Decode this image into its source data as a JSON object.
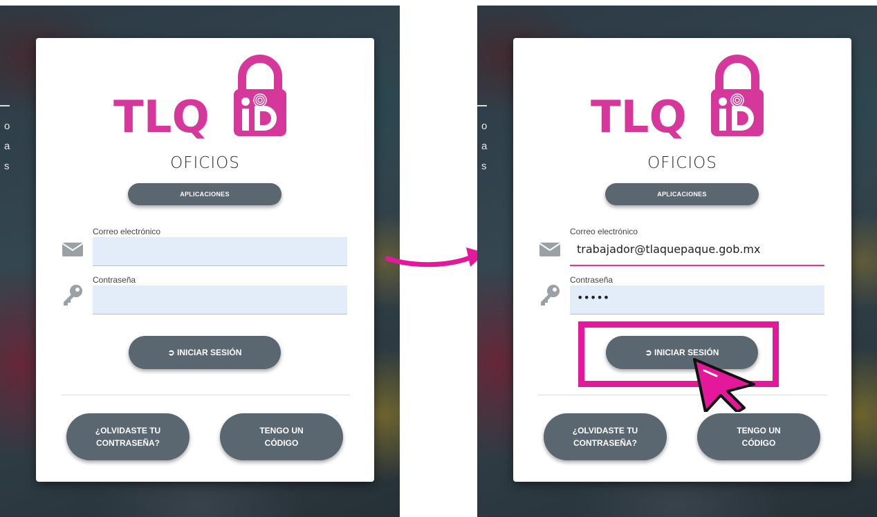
{
  "brand": {
    "logo_text": "TLQ",
    "logo_id": "iD",
    "color": "#d6379a"
  },
  "section_title": "OFICIOS",
  "background_side_text": [
    "o",
    "a",
    "s"
  ],
  "buttons": {
    "apps": "APLICACIONES",
    "login": "INICIAR SESIÓN",
    "forgot_line1": "¿OLVIDASTE TU",
    "forgot_line2": "CONTRASEÑA?",
    "code_line1": "TENGO UN",
    "code_line2": "CÓDIGO"
  },
  "login_before": {
    "email_label": "Correo electrónico",
    "email_value": "",
    "password_label": "Contraseña",
    "password_value": ""
  },
  "login_after": {
    "email_label": "Correo electrónico",
    "email_value": "trabajador@tlaquepaque.gob.mx",
    "password_label": "Contraseña",
    "password_value": "•••••"
  },
  "colors": {
    "button": "#5a6670",
    "accent": "#e3189a",
    "field_bg": "#e3edfa"
  },
  "icons": [
    "envelope-icon",
    "key-icon",
    "login-icon",
    "lock-icon",
    "fingerprint-icon",
    "cursor-icon",
    "arrow-icon"
  ]
}
